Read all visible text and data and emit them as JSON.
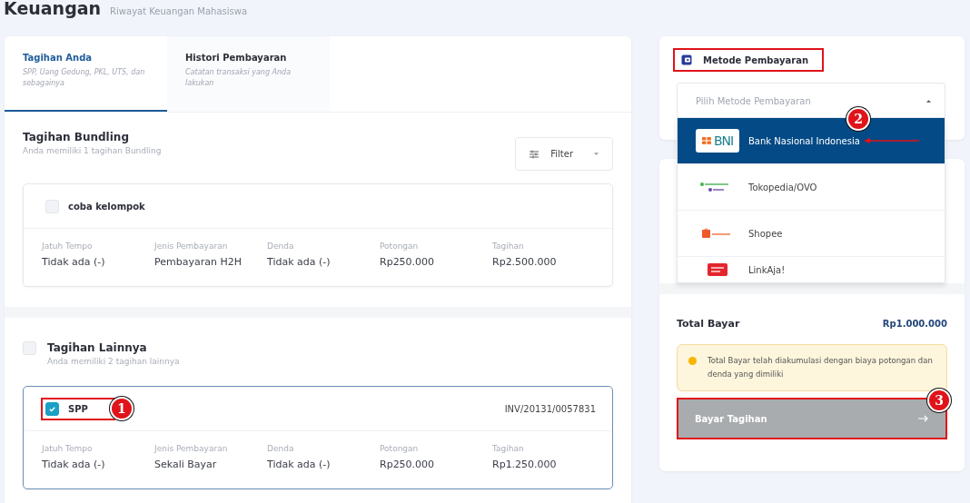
{
  "header": {
    "title": "Keuangan",
    "subtitle": "Riwayat Keuangan Mahasiswa"
  },
  "tabs": [
    {
      "label": "Tagihan Anda",
      "description": "SPP, Uang Gedung, PKL, UTS, dan sebagainya",
      "selected": true
    },
    {
      "label": "Histori Pembayaran",
      "description": "Catatan transaksi yang Anda lakukan",
      "selected": false
    }
  ],
  "bundling": {
    "title": "Tagihan Bundling",
    "subtitle": "Anda memiliki 1 tagihan Bundling",
    "filter_label": "Filter",
    "bills": [
      {
        "name": "coba kelompok",
        "checked": false,
        "fields": [
          {
            "label": "Jatuh Tempo",
            "value": "Tidak ada (-)"
          },
          {
            "label": "Jenis Pembayaran",
            "value": "Pembayaran H2H"
          },
          {
            "label": "Denda",
            "value": "Tidak ada (-)"
          },
          {
            "label": "Potongan",
            "value": "Rp250.000"
          },
          {
            "label": "Tagihan",
            "value": "Rp2.500.000"
          }
        ]
      }
    ]
  },
  "others": {
    "title": "Tagihan Lainnya",
    "subtitle": "Anda memiliki 2 tagihan lainnya",
    "checked": false,
    "bills": [
      {
        "name": "SPP",
        "invoice": "INV/20131/0057831",
        "checked": true,
        "highlighted": true,
        "callout": "1",
        "fields": [
          {
            "label": "Jatuh Tempo",
            "value": "Tidak ada (-)"
          },
          {
            "label": "Jenis Pembayaran",
            "value": "Sekali Bayar"
          },
          {
            "label": "Denda",
            "value": "Tidak ada (-)"
          },
          {
            "label": "Potongan",
            "value": "Rp250.000"
          },
          {
            "label": "Tagihan",
            "value": "Rp1.250.000"
          }
        ]
      }
    ]
  },
  "payment": {
    "title": "Metode Pembayaran",
    "highlighted": true,
    "select_placeholder": "Pilih Metode Pembayaran",
    "expanded": true,
    "options": [
      {
        "label": "Bank Nasional Indonesia",
        "kind": "bni",
        "logo_text": "BNI",
        "selected": true,
        "callout": "2"
      },
      {
        "label": "Tokopedia/OVO",
        "kind": "tokopedia-ovo",
        "selected": false
      },
      {
        "label": "Shopee",
        "kind": "shopee",
        "selected": false
      },
      {
        "label": "LinkAja!",
        "kind": "linkaja",
        "selected": false
      }
    ],
    "total_label": "Total Bayar",
    "total_value": "Rp1.000.000",
    "notice": "Total Bayar telah diakumulasi dengan biaya potongan dan denda yang dimiliki",
    "pay_button": {
      "label": "Bayar Tagihan",
      "disabled": true,
      "highlighted": true,
      "callout": "3"
    }
  }
}
